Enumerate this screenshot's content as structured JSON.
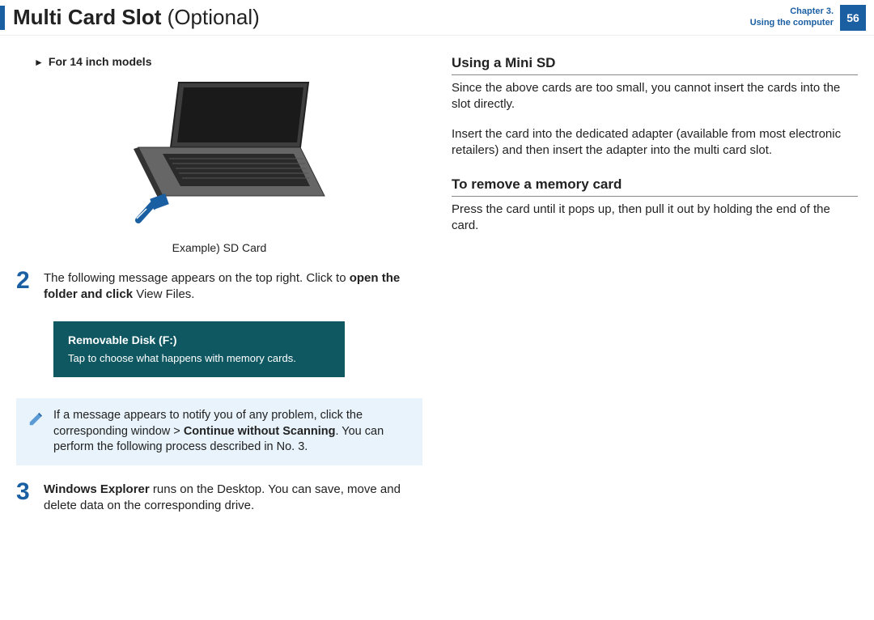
{
  "header": {
    "title_main": "Multi Card Slot",
    "title_sub": " (Optional)",
    "chapter_line1": "Chapter 3.",
    "chapter_line2": "Using the computer",
    "page_number": "56"
  },
  "left": {
    "models_heading": "For 14 inch models",
    "caption": "Example) SD Card",
    "step2": {
      "num": "2",
      "text_a": "The following message appears on the top right. Click to ",
      "text_b_bold": "open the folder and click",
      "text_c": " View Files."
    },
    "toast": {
      "title": "Removable Disk (F:)",
      "body": "Tap to choose what happens with memory cards."
    },
    "note": {
      "text_a": "If a message appears to notify you of any problem, click the corresponding window > ",
      "text_b_bold": "Continue without Scanning",
      "text_c": ". You can perform the following process described in No. 3."
    },
    "step3": {
      "num": "3",
      "text_a_bold": "Windows Explorer",
      "text_b": " runs on the Desktop. You can save, move and delete data on the corresponding drive."
    }
  },
  "right": {
    "h1": "Using a Mini SD",
    "p1": "Since the above cards are too small, you cannot insert the cards into the slot directly.",
    "p2": "Insert the card into the dedicated adapter (available from most electronic retailers) and then insert the adapter into the multi card slot.",
    "h2": "To remove a memory card",
    "p3": "Press the card until it pops up, then pull it out by holding the end of the card."
  }
}
